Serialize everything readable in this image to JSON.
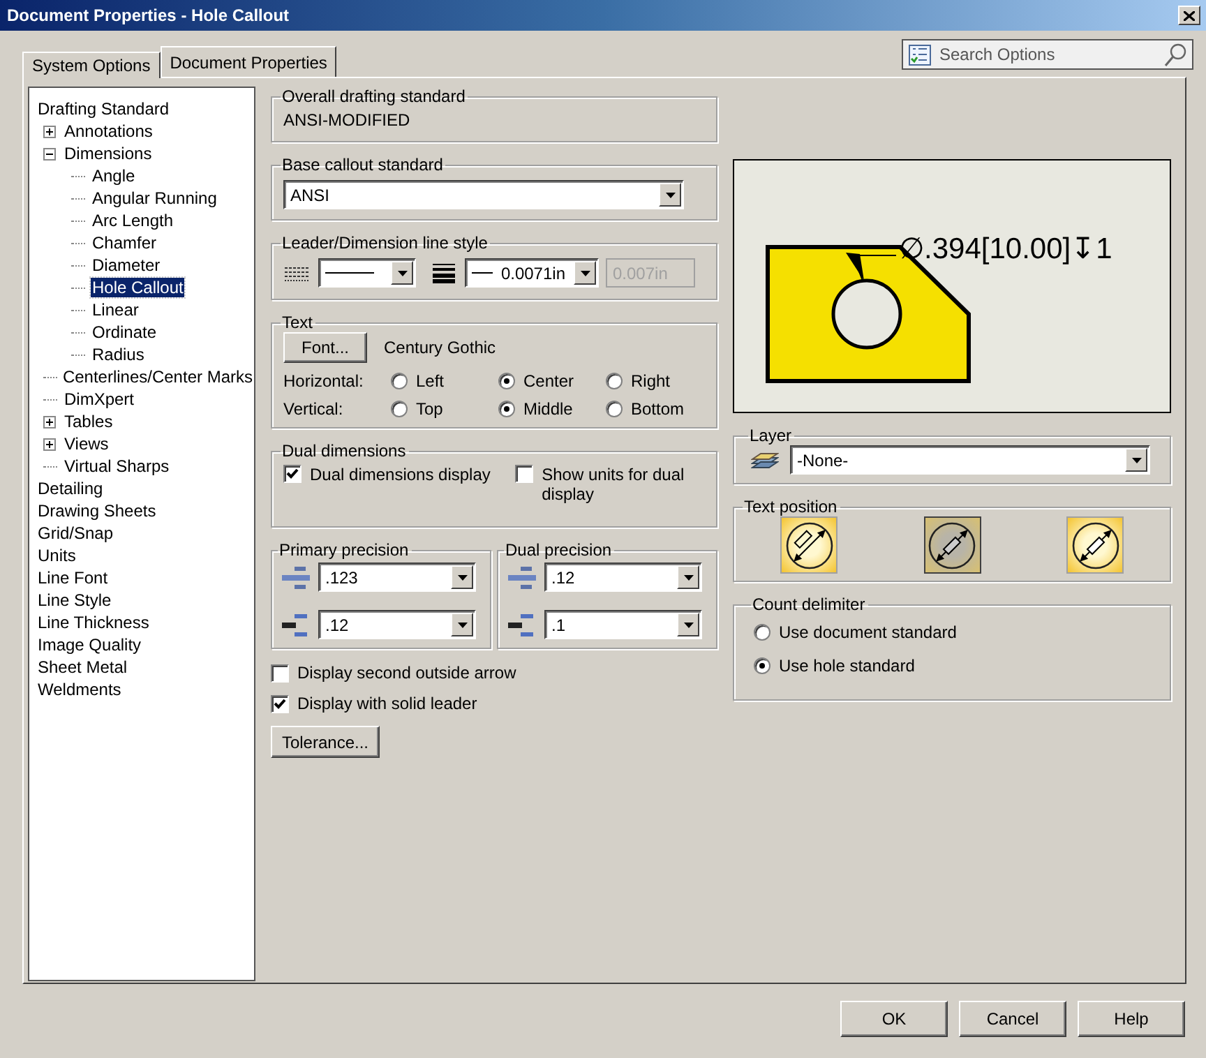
{
  "window": {
    "title": "Document Properties - Hole Callout"
  },
  "tabs": [
    {
      "label": "System Options",
      "selected": false
    },
    {
      "label": "Document Properties",
      "selected": true
    }
  ],
  "search": {
    "placeholder": "Search Options"
  },
  "tree": [
    {
      "label": "Drafting Standard",
      "selected": false,
      "children": [
        {
          "label": "Annotations",
          "expanded": false,
          "selected": false
        },
        {
          "label": "Dimensions",
          "expanded": true,
          "selected": false,
          "children": [
            {
              "label": "Angle",
              "selected": false
            },
            {
              "label": "Angular Running",
              "selected": false
            },
            {
              "label": "Arc Length",
              "selected": false
            },
            {
              "label": "Chamfer",
              "selected": false
            },
            {
              "label": "Diameter",
              "selected": false
            },
            {
              "label": "Hole Callout",
              "selected": true
            },
            {
              "label": "Linear",
              "selected": false
            },
            {
              "label": "Ordinate",
              "selected": false
            },
            {
              "label": "Radius",
              "selected": false
            }
          ]
        },
        {
          "label": "Centerlines/Center Marks",
          "selected": false
        },
        {
          "label": "DimXpert",
          "selected": false
        },
        {
          "label": "Tables",
          "expanded": false,
          "selected": false
        },
        {
          "label": "Views",
          "expanded": false,
          "selected": false
        },
        {
          "label": "Virtual Sharps",
          "selected": false
        }
      ]
    },
    {
      "label": "Detailing",
      "selected": false
    },
    {
      "label": "Drawing Sheets",
      "selected": false
    },
    {
      "label": "Grid/Snap",
      "selected": false
    },
    {
      "label": "Units",
      "selected": false
    },
    {
      "label": "Line Font",
      "selected": false
    },
    {
      "label": "Line Style",
      "selected": false
    },
    {
      "label": "Line Thickness",
      "selected": false
    },
    {
      "label": "Image Quality",
      "selected": false
    },
    {
      "label": "Sheet Metal",
      "selected": false
    },
    {
      "label": "Weldments",
      "selected": false
    }
  ],
  "overall_standard": {
    "title": "Overall drafting standard",
    "value": "ANSI-MODIFIED"
  },
  "base_callout": {
    "title": "Base callout standard",
    "value": "ANSI"
  },
  "leader_style": {
    "title": "Leader/Dimension line style",
    "thickness": "0.0071in",
    "custom": "0.007in",
    "custom_disabled": true
  },
  "text": {
    "title": "Text",
    "font_button": "Font...",
    "font_name": "Century Gothic",
    "rows": [
      {
        "label": "Horizontal:",
        "options": [
          {
            "label": "Left",
            "selected": false
          },
          {
            "label": "Center",
            "selected": true
          },
          {
            "label": "Right",
            "selected": false
          }
        ]
      },
      {
        "label": "Vertical:",
        "options": [
          {
            "label": "Top",
            "selected": false
          },
          {
            "label": "Middle",
            "selected": true
          },
          {
            "label": "Bottom",
            "selected": false
          }
        ]
      }
    ]
  },
  "dual": {
    "title": "Dual dimensions",
    "options": [
      {
        "label": "Dual dimensions display",
        "checked": true
      },
      {
        "label": "Show units for dual display",
        "checked": false
      }
    ]
  },
  "precision": [
    {
      "title": "Primary precision",
      "value": ".123",
      "tolerance": ".12"
    },
    {
      "title": "Dual precision",
      "value": ".12",
      "tolerance": ".1"
    }
  ],
  "checkboxes": [
    {
      "label": "Display second outside arrow",
      "checked": false
    },
    {
      "label": "Display with solid leader",
      "checked": true
    }
  ],
  "tolerance_button": "Tolerance...",
  "preview": {
    "callout": "∅.394[10.00]↧1"
  },
  "layer": {
    "title": "Layer",
    "value": "-None-"
  },
  "text_position": {
    "title": "Text position",
    "options": [
      {
        "kind": "offset",
        "selected": false
      },
      {
        "kind": "centered",
        "selected": true
      },
      {
        "kind": "aligned",
        "selected": false
      }
    ]
  },
  "count_delimiter": {
    "title": "Count delimiter",
    "options": [
      {
        "label": "Use document standard",
        "selected": false
      },
      {
        "label": "Use hole standard",
        "selected": true
      }
    ]
  },
  "buttons": [
    "OK",
    "Cancel",
    "Help"
  ]
}
